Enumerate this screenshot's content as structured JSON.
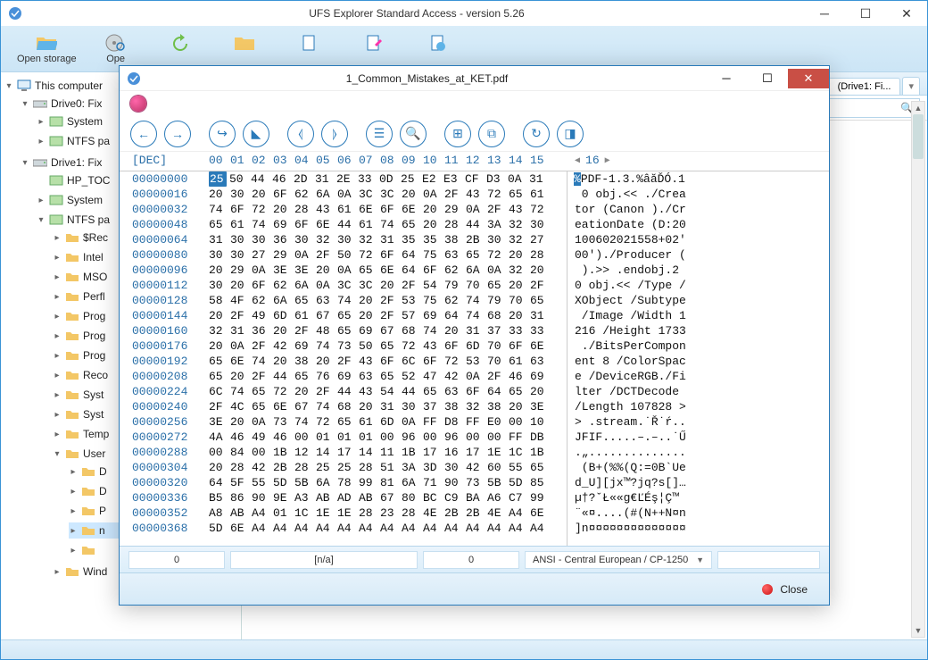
{
  "main": {
    "title": "UFS Explorer Standard Access - version 5.26",
    "toolbar": [
      {
        "label": "Open storage"
      },
      {
        "label": "Ope"
      }
    ],
    "tab_label": "(Drive1: Fi...",
    "search_placeholder": ""
  },
  "tree": {
    "root": "This computer",
    "drive0": "Drive0: Fix",
    "drive0_children": [
      "System",
      "NTFS pa"
    ],
    "drive1": "Drive1: Fix",
    "drive1_children": {
      "hp": "HP_TOC",
      "sys": "System",
      "ntfs": "NTFS pa",
      "ntfs_children": [
        "$Rec",
        "Intel",
        "MSO",
        "Perfl",
        "Prog",
        "Prog",
        "Prog",
        "Reco",
        "Syst",
        "Syst",
        "Temp"
      ],
      "users": "User",
      "users_children": [
        "D",
        "D",
        "P",
        "n",
        ""
      ],
      "wind": "Wind"
    }
  },
  "hex": {
    "title": "1_Common_Mistakes_at_KET.pdf",
    "dec_label": "[DEC]",
    "col_headers": [
      "00",
      "01",
      "02",
      "03",
      "04",
      "05",
      "06",
      "07",
      "08",
      "09",
      "10",
      "11",
      "12",
      "13",
      "14",
      "15"
    ],
    "txt_col_start": "16",
    "rows": [
      {
        "off": "00000000",
        "b": [
          "25",
          "50",
          "44",
          "46",
          "2D",
          "31",
          "2E",
          "33",
          "0D",
          "25",
          "E2",
          "E3",
          "CF",
          "D3",
          "0A",
          "31"
        ],
        "t": "%PDF-1.3.%âăĎÓ.1",
        "hl": 0
      },
      {
        "off": "00000016",
        "b": [
          "20",
          "30",
          "20",
          "6F",
          "62",
          "6A",
          "0A",
          "3C",
          "3C",
          "20",
          "0A",
          "2F",
          "43",
          "72",
          "65",
          "61"
        ],
        "t": " 0 obj.<< ./Crea"
      },
      {
        "off": "00000032",
        "b": [
          "74",
          "6F",
          "72",
          "20",
          "28",
          "43",
          "61",
          "6E",
          "6F",
          "6E",
          "20",
          "29",
          "0A",
          "2F",
          "43",
          "72"
        ],
        "t": "tor (Canon )./Cr"
      },
      {
        "off": "00000048",
        "b": [
          "65",
          "61",
          "74",
          "69",
          "6F",
          "6E",
          "44",
          "61",
          "74",
          "65",
          "20",
          "28",
          "44",
          "3A",
          "32",
          "30"
        ],
        "t": "eationDate (D:20"
      },
      {
        "off": "00000064",
        "b": [
          "31",
          "30",
          "30",
          "36",
          "30",
          "32",
          "30",
          "32",
          "31",
          "35",
          "35",
          "38",
          "2B",
          "30",
          "32",
          "27"
        ],
        "t": "100602021558+02'"
      },
      {
        "off": "00000080",
        "b": [
          "30",
          "30",
          "27",
          "29",
          "0A",
          "2F",
          "50",
          "72",
          "6F",
          "64",
          "75",
          "63",
          "65",
          "72",
          "20",
          "28"
        ],
        "t": "00')./Producer ("
      },
      {
        "off": "00000096",
        "b": [
          "20",
          "29",
          "0A",
          "3E",
          "3E",
          "20",
          "0A",
          "65",
          "6E",
          "64",
          "6F",
          "62",
          "6A",
          "0A",
          "32",
          "20"
        ],
        "t": " ).>> .endobj.2 "
      },
      {
        "off": "00000112",
        "b": [
          "30",
          "20",
          "6F",
          "62",
          "6A",
          "0A",
          "3C",
          "3C",
          "20",
          "2F",
          "54",
          "79",
          "70",
          "65",
          "20",
          "2F"
        ],
        "t": "0 obj.<< /Type /"
      },
      {
        "off": "00000128",
        "b": [
          "58",
          "4F",
          "62",
          "6A",
          "65",
          "63",
          "74",
          "20",
          "2F",
          "53",
          "75",
          "62",
          "74",
          "79",
          "70",
          "65"
        ],
        "t": "XObject /Subtype"
      },
      {
        "off": "00000144",
        "b": [
          "20",
          "2F",
          "49",
          "6D",
          "61",
          "67",
          "65",
          "20",
          "2F",
          "57",
          "69",
          "64",
          "74",
          "68",
          "20",
          "31"
        ],
        "t": " /Image /Width 1"
      },
      {
        "off": "00000160",
        "b": [
          "32",
          "31",
          "36",
          "20",
          "2F",
          "48",
          "65",
          "69",
          "67",
          "68",
          "74",
          "20",
          "31",
          "37",
          "33",
          "33"
        ],
        "t": "216 /Height 1733"
      },
      {
        "off": "00000176",
        "b": [
          "20",
          "0A",
          "2F",
          "42",
          "69",
          "74",
          "73",
          "50",
          "65",
          "72",
          "43",
          "6F",
          "6D",
          "70",
          "6F",
          "6E"
        ],
        "t": " ./BitsPerCompon"
      },
      {
        "off": "00000192",
        "b": [
          "65",
          "6E",
          "74",
          "20",
          "38",
          "20",
          "2F",
          "43",
          "6F",
          "6C",
          "6F",
          "72",
          "53",
          "70",
          "61",
          "63"
        ],
        "t": "ent 8 /ColorSpac"
      },
      {
        "off": "00000208",
        "b": [
          "65",
          "20",
          "2F",
          "44",
          "65",
          "76",
          "69",
          "63",
          "65",
          "52",
          "47",
          "42",
          "0A",
          "2F",
          "46",
          "69"
        ],
        "t": "e /DeviceRGB./Fi"
      },
      {
        "off": "00000224",
        "b": [
          "6C",
          "74",
          "65",
          "72",
          "20",
          "2F",
          "44",
          "43",
          "54",
          "44",
          "65",
          "63",
          "6F",
          "64",
          "65",
          "20"
        ],
        "t": "lter /DCTDecode "
      },
      {
        "off": "00000240",
        "b": [
          "2F",
          "4C",
          "65",
          "6E",
          "67",
          "74",
          "68",
          "20",
          "31",
          "30",
          "37",
          "38",
          "32",
          "38",
          "20",
          "3E"
        ],
        "t": "/Length 107828 >"
      },
      {
        "off": "00000256",
        "b": [
          "3E",
          "20",
          "0A",
          "73",
          "74",
          "72",
          "65",
          "61",
          "6D",
          "0A",
          "FF",
          "D8",
          "FF",
          "E0",
          "00",
          "10"
        ],
        "t": "> .stream.˙Ř˙ŕ.."
      },
      {
        "off": "00000272",
        "b": [
          "4A",
          "46",
          "49",
          "46",
          "00",
          "01",
          "01",
          "01",
          "00",
          "96",
          "00",
          "96",
          "00",
          "00",
          "FF",
          "DB"
        ],
        "t": "JFIF.....–.–..˙Ű"
      },
      {
        "off": "00000288",
        "b": [
          "00",
          "84",
          "00",
          "1B",
          "12",
          "14",
          "17",
          "14",
          "11",
          "1B",
          "17",
          "16",
          "17",
          "1E",
          "1C",
          "1B"
        ],
        "t": ".„.............."
      },
      {
        "off": "00000304",
        "b": [
          "20",
          "28",
          "42",
          "2B",
          "28",
          "25",
          "25",
          "28",
          "51",
          "3A",
          "3D",
          "30",
          "42",
          "60",
          "55",
          "65"
        ],
        "t": " (B+(%%(Q:=0B`Ue"
      },
      {
        "off": "00000320",
        "b": [
          "64",
          "5F",
          "55",
          "5D",
          "5B",
          "6A",
          "78",
          "99",
          "81",
          "6A",
          "71",
          "90",
          "73",
          "5B",
          "5D",
          "85"
        ],
        "t": "d_U][jx™?jq?s[]…"
      },
      {
        "off": "00000336",
        "b": [
          "B5",
          "86",
          "90",
          "9E",
          "A3",
          "AB",
          "AD",
          "AB",
          "67",
          "80",
          "BC",
          "C9",
          "BA",
          "A6",
          "C7",
          "99"
        ],
        "t": "µ†?ˇŁ«­«g€ĽÉş¦Ç™"
      },
      {
        "off": "00000352",
        "b": [
          "A8",
          "AB",
          "A4",
          "01",
          "1C",
          "1E",
          "1E",
          "28",
          "23",
          "28",
          "4E",
          "2B",
          "2B",
          "4E",
          "A4",
          "6E"
        ],
        "t": "¨«¤....(#(N++N¤n"
      },
      {
        "off": "00000368",
        "b": [
          "5D",
          "6E",
          "A4",
          "A4",
          "A4",
          "A4",
          "A4",
          "A4",
          "A4",
          "A4",
          "A4",
          "A4",
          "A4",
          "A4",
          "A4",
          "A4"
        ],
        "t": "]n¤¤¤¤¤¤¤¤¤¤¤¤¤¤"
      }
    ],
    "status": {
      "pos": "0",
      "sel": "[n/a]",
      "size": "0",
      "encoding": "ANSI - Central European / CP-1250"
    },
    "close_label": "Close"
  }
}
